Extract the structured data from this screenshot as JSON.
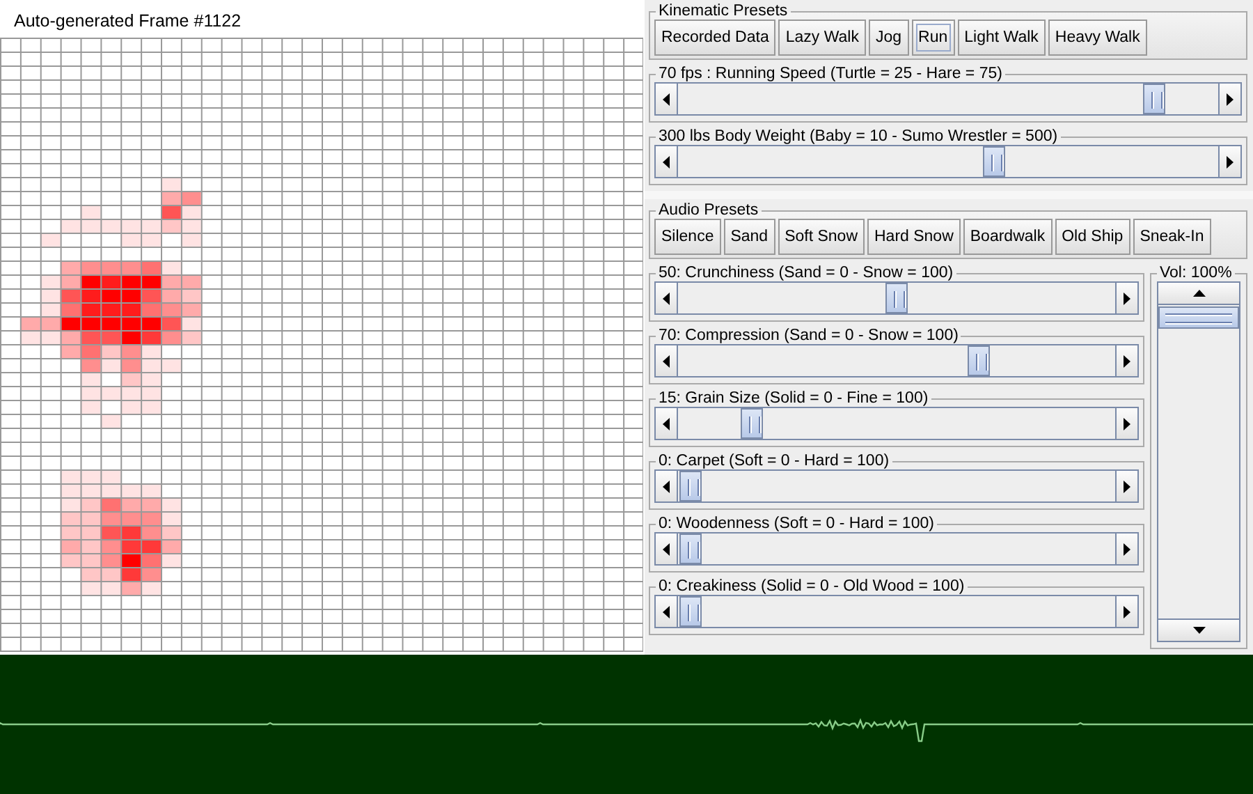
{
  "frame_title": "Auto-generated Frame #1122",
  "kinematic_presets": {
    "title": "Kinematic Presets",
    "buttons": [
      {
        "label": "Recorded Data",
        "selected": false
      },
      {
        "label": "Lazy Walk",
        "selected": false
      },
      {
        "label": "Jog",
        "selected": false
      },
      {
        "label": "Run",
        "selected": true
      },
      {
        "label": "Light Walk",
        "selected": false
      },
      {
        "label": "Heavy Walk",
        "selected": false
      }
    ]
  },
  "kinematic_sliders": [
    {
      "label": "70 fps : Running Speed (Turtle = 25 - Hare = 75)",
      "level": 0.9
    },
    {
      "label": "300 lbs Body Weight (Baby = 10 - Sumo Wrestler = 500)",
      "level": 0.59
    }
  ],
  "audio_presets": {
    "title": "Audio Presets",
    "buttons": [
      {
        "label": "Silence",
        "selected": false
      },
      {
        "label": "Sand",
        "selected": false
      },
      {
        "label": "Soft Snow",
        "selected": false
      },
      {
        "label": "Hard Snow",
        "selected": false
      },
      {
        "label": "Boardwalk",
        "selected": false
      },
      {
        "label": "Old Ship",
        "selected": false
      },
      {
        "label": "Sneak-In",
        "selected": false
      }
    ]
  },
  "audio_sliders": [
    {
      "label": "50: Crunchiness (Sand = 0 - Snow = 100)",
      "level": 0.5
    },
    {
      "label": "70: Compression (Sand = 0 - Snow = 100)",
      "level": 0.7
    },
    {
      "label": "15: Grain Size (Solid = 0 - Fine = 100)",
      "level": 0.15
    },
    {
      "label": "0: Carpet (Soft = 0 - Hard = 100)",
      "level": 0
    },
    {
      "label": "0: Woodenness (Soft = 0 - Hard = 100)",
      "level": 0
    },
    {
      "label": "0: Creakiness (Solid = 0 - Old Wood = 100)",
      "level": 0
    }
  ],
  "volume": {
    "label": "Vol: 100%",
    "level": 1
  }
}
